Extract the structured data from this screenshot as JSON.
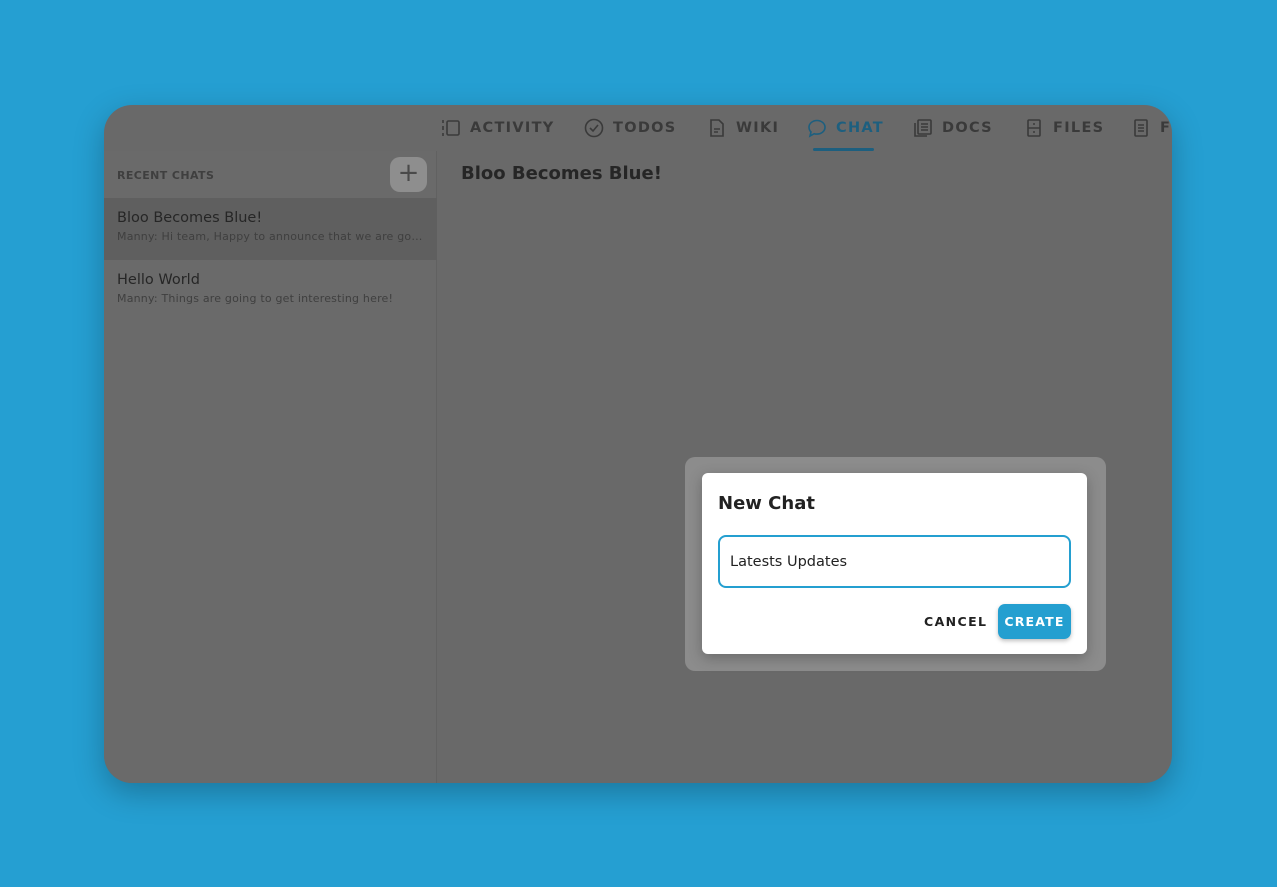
{
  "tabs": [
    {
      "label": "ACTIVITY",
      "icon": "activity-icon"
    },
    {
      "label": "TODOS",
      "icon": "check-circle-icon"
    },
    {
      "label": "WIKI",
      "icon": "document-icon"
    },
    {
      "label": "CHAT",
      "icon": "chat-bubble-icon",
      "active": true
    },
    {
      "label": "DOCS",
      "icon": "docs-icon"
    },
    {
      "label": "FILES",
      "icon": "file-cabinet-icon"
    },
    {
      "label": "F",
      "icon": "form-icon"
    }
  ],
  "sidebar": {
    "heading": "RECENT CHATS",
    "add_label": "+",
    "items": [
      {
        "title": "Bloo Becomes Blue!",
        "preview": "Manny: Hi team, Happy to announce that we are going to be blue!",
        "selected": true
      },
      {
        "title": "Hello World",
        "preview": "Manny: Things are going to get interesting here!"
      }
    ]
  },
  "main": {
    "title": "Bloo Becomes Blue!"
  },
  "dialog": {
    "title": "New Chat",
    "input_value": "Latests Updates",
    "cancel_label": "CANCEL",
    "create_label": "CREATE"
  },
  "colors": {
    "background": "#259fd2",
    "accent": "#249fd0"
  }
}
